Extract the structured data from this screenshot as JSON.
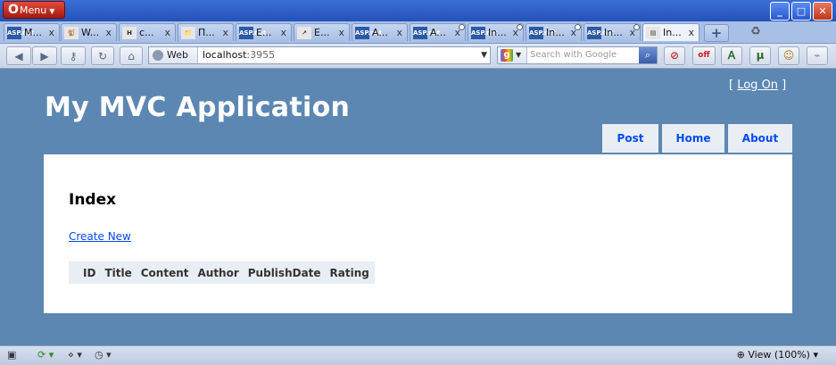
{
  "window": {
    "menu_label": "Menu",
    "controls": [
      "_",
      "□",
      "✕"
    ]
  },
  "tabs": [
    {
      "fav": "ASP.net",
      "label": "M...",
      "close": "x"
    },
    {
      "fav": "🐒",
      "label": "W...",
      "close": "x"
    },
    {
      "fav": "H",
      "label": "c...",
      "close": "x"
    },
    {
      "fav": "📁",
      "label": "П...",
      "close": "x"
    },
    {
      "fav": "ASP.net",
      "label": "E...",
      "close": "x"
    },
    {
      "fav": "↗",
      "label": "E...",
      "close": "x"
    },
    {
      "fav": "ASP.net",
      "label": "A...",
      "close": "x"
    },
    {
      "fav": "ASP.net",
      "label": "A...",
      "close": "x"
    },
    {
      "fav": "ASP.net",
      "label": "In...",
      "close": "x"
    },
    {
      "fav": "ASP.net",
      "label": "In...",
      "close": "x"
    },
    {
      "fav": "ASP.net",
      "label": "In...",
      "close": "x"
    },
    {
      "fav": "▤",
      "label": "In...",
      "close": "x",
      "active": true
    }
  ],
  "toolbar": {
    "back_icon": "◀",
    "forward_icon": "▶",
    "wand_icon": "🔑",
    "reload_icon": "↻",
    "home_icon": "⌂",
    "address_mode": "Web",
    "url_host": "localhost",
    "url_port": ":3955",
    "search_engine_letter": "g",
    "search_placeholder": "Search with Google",
    "search_go_icon": "🔍",
    "extensions": [
      {
        "name": "adblock-icon",
        "glyph": "⊘"
      },
      {
        "name": "turbo-off-icon",
        "glyph": "off"
      },
      {
        "name": "translate-icon",
        "glyph": "Ａ"
      },
      {
        "name": "utorrent-icon",
        "glyph": "µ"
      },
      {
        "name": "notes-icon",
        "glyph": "☺"
      },
      {
        "name": "rss-icon",
        "glyph": "⌁"
      }
    ]
  },
  "page": {
    "logon_prefix": "[ ",
    "logon_link": "Log On",
    "logon_suffix": " ]",
    "app_title": "My MVC Application",
    "nav": [
      "Post",
      "Home",
      "About"
    ],
    "heading": "Index",
    "create_link": "Create New",
    "columns": [
      "ID",
      "Title",
      "Content",
      "Author",
      "PublishDate",
      "Rating"
    ]
  },
  "statusbar": {
    "panel_icon": "▣",
    "sync_icon": "⟳",
    "share_icon": "⋄",
    "speed_icon": "◷",
    "zoom_text": "View (100%)",
    "zoom_icon": "🔍"
  },
  "colors": {
    "page_bg": "#5c87b2",
    "link": "#034af3",
    "nav_bg": "#e8eef4"
  }
}
